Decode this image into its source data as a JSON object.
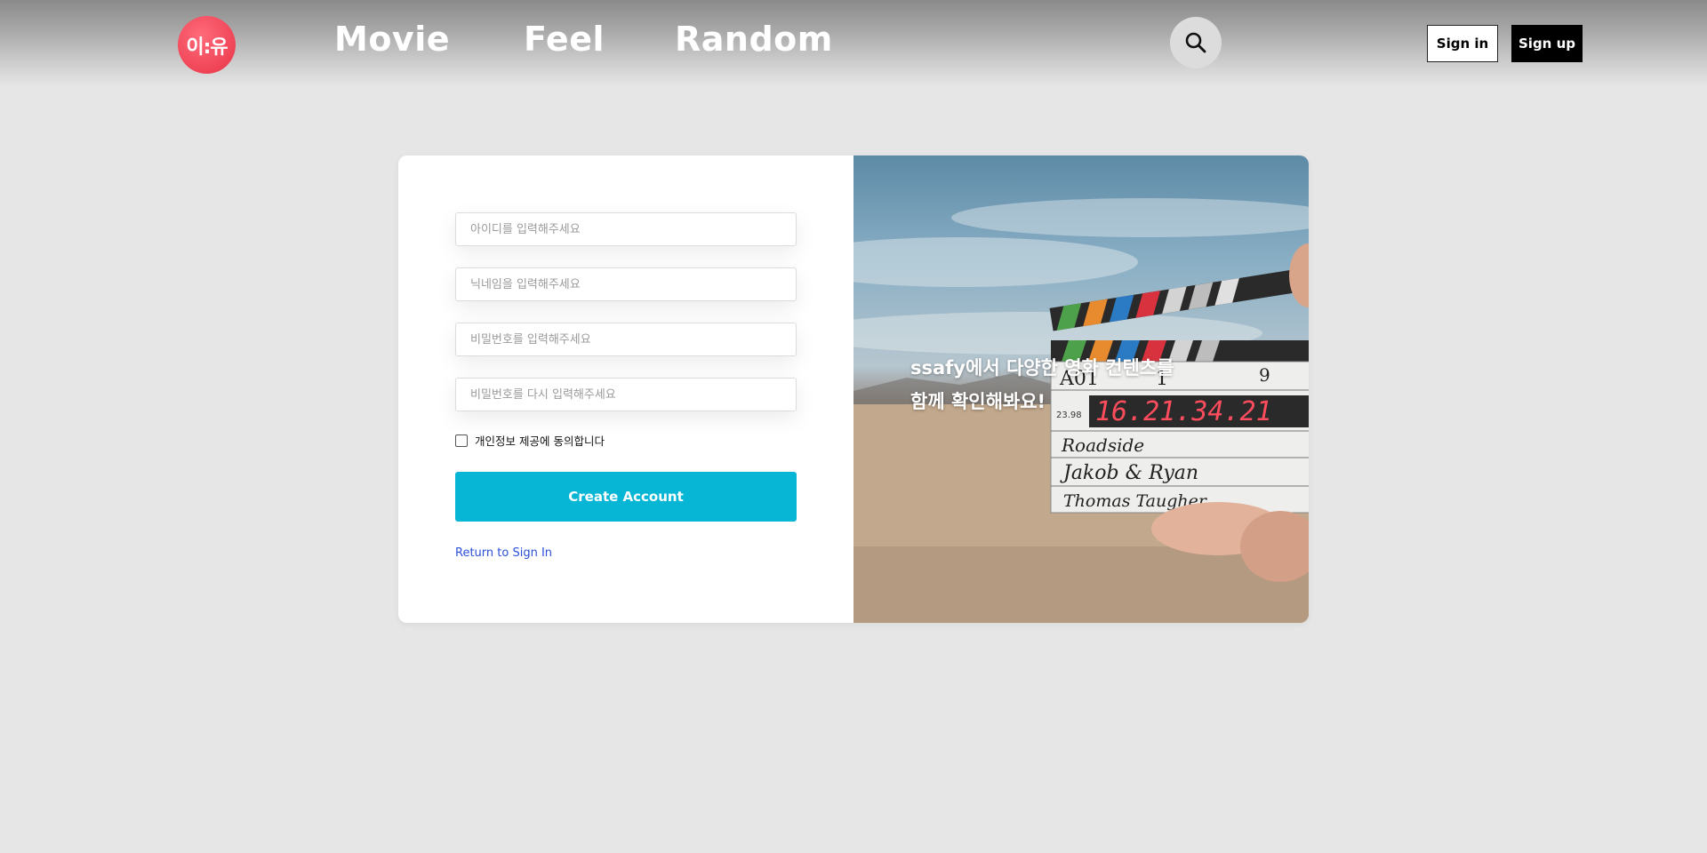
{
  "header": {
    "logo_text": "이:유",
    "nav": [
      {
        "label": "Movie"
      },
      {
        "label": "Feel"
      },
      {
        "label": "Random"
      }
    ],
    "search_icon": "search-icon",
    "signin_label": "Sign in",
    "signup_label": "Sign up"
  },
  "form": {
    "fields": [
      {
        "placeholder": "아이디를 입력해주세요",
        "value": ""
      },
      {
        "placeholder": "닉네임을 입력해주세요",
        "value": ""
      },
      {
        "placeholder": "비밀번호를 입력해주세요",
        "value": ""
      },
      {
        "placeholder": "비밀번호를 다시 입력해주세요",
        "value": ""
      }
    ],
    "agree_label": "개인정보 제공에 동의합니다",
    "agree_checked": false,
    "create_label": "Create Account",
    "return_label": "Return to Sign In"
  },
  "promo": {
    "line1": "ssafy에서 다양한 영화 컨텐츠를",
    "line2": "함께 확인해봐요!",
    "clapper": {
      "scene": "A01",
      "take": "1",
      "roll": "9",
      "fps": "23.98",
      "timecode": "16.21.34.21",
      "production": "Roadside",
      "director": "Jakob & Ryan",
      "camera": "Thomas Taugher"
    }
  },
  "colors": {
    "accent": "#06b6d4",
    "logo": "#ef4456",
    "link": "#2b4fd6"
  }
}
